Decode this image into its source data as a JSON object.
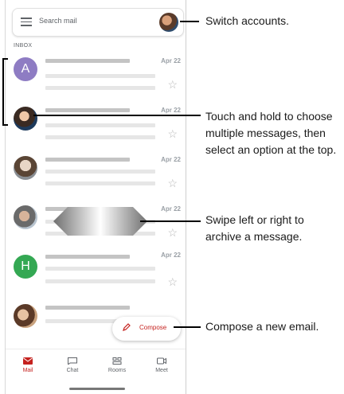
{
  "search": {
    "placeholder": "Search mail"
  },
  "inbox": {
    "label": "INBOX",
    "rows": [
      {
        "avatar_letter": "A",
        "avatar_color": "#8e7cc3",
        "date": "Apr 22"
      },
      {
        "avatar_letter": "",
        "avatar_color": "",
        "date": "Apr 22"
      },
      {
        "avatar_letter": "",
        "avatar_color": "",
        "date": "Apr 22"
      },
      {
        "avatar_letter": "",
        "avatar_color": "",
        "date": "Apr 22"
      },
      {
        "avatar_letter": "H",
        "avatar_color": "#34a853",
        "date": "Apr 22"
      },
      {
        "avatar_letter": "",
        "avatar_color": "",
        "date": ""
      }
    ]
  },
  "compose": {
    "label": "Compose"
  },
  "nav": {
    "items": [
      "Mail",
      "Chat",
      "Rooms",
      "Meet"
    ],
    "active": "Mail",
    "accent": "#c5221f"
  },
  "callouts": {
    "switch_accounts": "Switch accounts.",
    "touch_hold_1": "Touch and hold to choose",
    "touch_hold_2": "multiple messages, then",
    "touch_hold_3": "select an option at the top.",
    "swipe_1": "Swipe left or right to",
    "swipe_2": "archive a message.",
    "compose_new": "Compose a new email."
  }
}
